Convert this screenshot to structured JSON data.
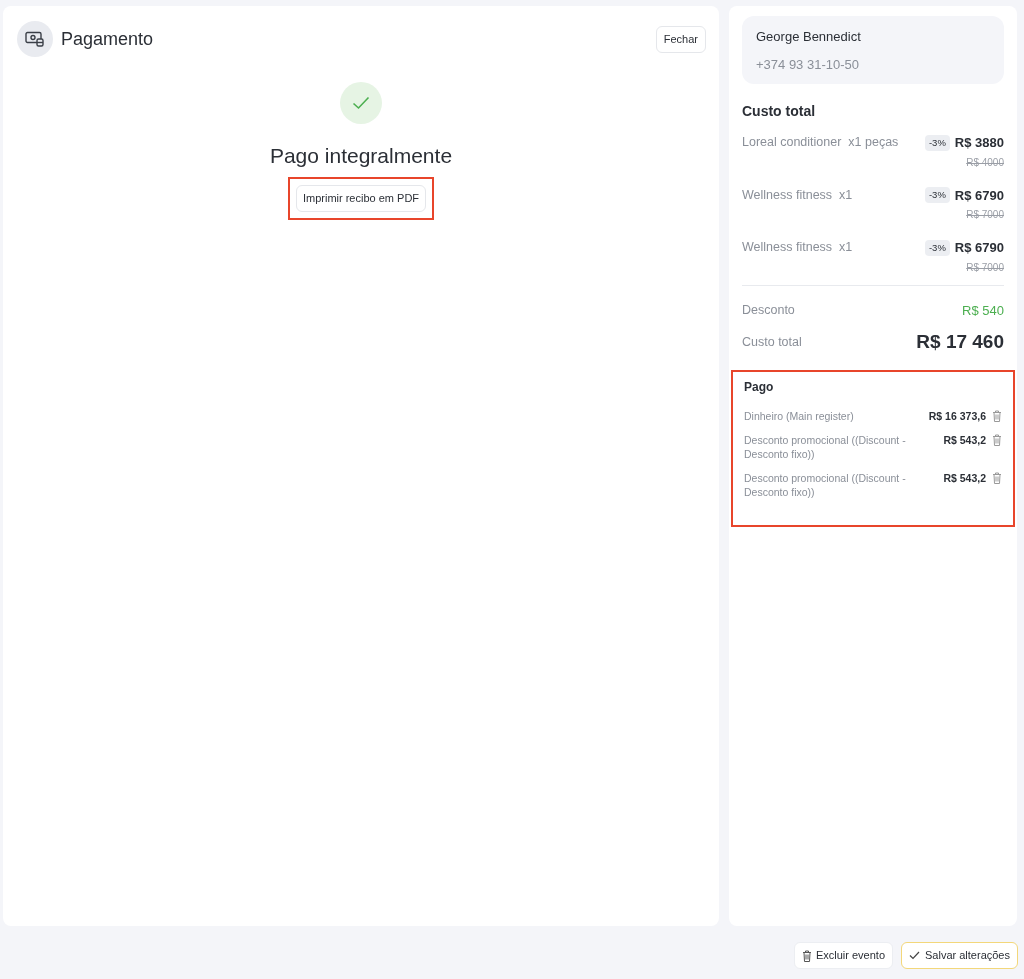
{
  "header": {
    "title": "Pagamento",
    "close_button": "Fechar"
  },
  "status": {
    "title": "Pago integralmente",
    "print_button": "Imprimir recibo em PDF",
    "print_highlighted": true
  },
  "client": {
    "name": "George Bennedict",
    "phone": "+374 93 31-10-50"
  },
  "cost": {
    "title": "Custo total",
    "items": [
      {
        "name": "Loreal conditioner  x1 peças",
        "discount": "-3%",
        "price": "R$ 3880",
        "old_price": "R$ 4000"
      },
      {
        "name": "Wellness fitness  x1",
        "discount": "-3%",
        "price": "R$ 6790",
        "old_price": "R$ 7000"
      },
      {
        "name": "Wellness fitness  x1",
        "discount": "-3%",
        "price": "R$ 6790",
        "old_price": "R$ 7000"
      }
    ],
    "discount_label": "Desconto",
    "discount_value": "R$ 540",
    "total_label": "Custo total",
    "total_value": "R$ 17 460"
  },
  "paid": {
    "title": "Pago",
    "highlighted": true,
    "items": [
      {
        "name": "Dinheiro (Main register)",
        "amount": "R$ 16 373,6"
      },
      {
        "name": "Desconto promocional ((Discount - Desconto fixo))",
        "amount": "R$ 543,2"
      },
      {
        "name": "Desconto promocional ((Discount - Desconto fixo))",
        "amount": "R$ 543,2"
      }
    ]
  },
  "footer": {
    "delete_button": "Excluir evento",
    "save_button": "Salvar alterações"
  }
}
